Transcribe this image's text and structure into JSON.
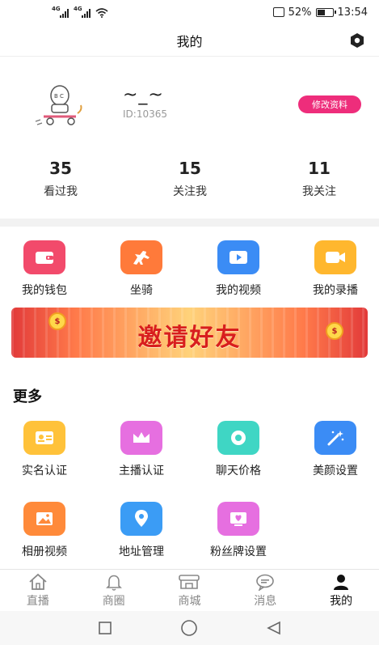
{
  "status_bar": {
    "network_1": "4G",
    "network_2": "4G",
    "battery": "52%",
    "time": "13:54",
    "battery_level": 0.52
  },
  "header": {
    "title": "我的",
    "settings_icon": "hexagon-settings-icon"
  },
  "profile": {
    "nickname": "~_~",
    "user_id": "ID:10365",
    "edit_label": "修改资料",
    "edit_color": "#ee2d7b"
  },
  "stats": [
    {
      "value": "35",
      "label": "看过我"
    },
    {
      "value": "15",
      "label": "关注我"
    },
    {
      "value": "11",
      "label": "我关注"
    }
  ],
  "quick_menu": [
    {
      "label": "我的钱包",
      "icon": "wallet-icon",
      "color": "#f24a6b"
    },
    {
      "label": "坐骑",
      "icon": "horse-icon",
      "color": "#ff7a3a"
    },
    {
      "label": "我的视频",
      "icon": "play-icon",
      "color": "#3b8cf5"
    },
    {
      "label": "我的录播",
      "icon": "video-camera-icon",
      "color": "#ffb72e"
    }
  ],
  "banner": {
    "text": "邀请好友",
    "coin_left": "$",
    "coin_right": "$"
  },
  "more": {
    "title": "更多",
    "items": [
      {
        "label": "实名认证",
        "icon": "id-card-icon",
        "color": "#ffc23a"
      },
      {
        "label": "主播认证",
        "icon": "crown-icon",
        "color": "#e66fe0"
      },
      {
        "label": "聊天价格",
        "icon": "chat-price-icon",
        "color": "#3fd6c4"
      },
      {
        "label": "美颜设置",
        "icon": "magic-wand-icon",
        "color": "#3b8cf5"
      },
      {
        "label": "相册视频",
        "icon": "photo-album-icon",
        "color": "#ff8a3a"
      },
      {
        "label": "地址管理",
        "icon": "location-pin-icon",
        "color": "#3b9cf5"
      },
      {
        "label": "粉丝牌设置",
        "icon": "fan-badge-icon",
        "color": "#e66fe0"
      }
    ]
  },
  "tabbar": [
    {
      "label": "直播",
      "icon": "home-icon"
    },
    {
      "label": "商圈",
      "icon": "bell-icon"
    },
    {
      "label": "商城",
      "icon": "store-icon"
    },
    {
      "label": "消息",
      "icon": "message-icon"
    },
    {
      "label": "我的",
      "icon": "profile-icon"
    }
  ],
  "active_tab": "我的"
}
